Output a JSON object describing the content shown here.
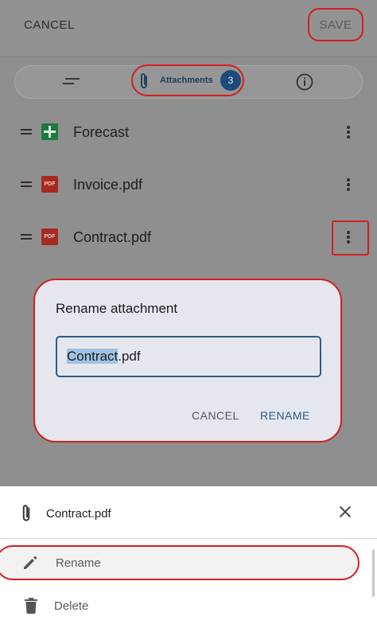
{
  "topbar": {
    "cancel_label": "CANCEL",
    "save_label": "SAVE"
  },
  "tabs": {
    "details_icon": "short-text-icon",
    "attachments_label": "Attachments",
    "attachments_count": "3",
    "info_icon": "info-icon"
  },
  "attachments": [
    {
      "name": "Forecast",
      "icon": "spreadsheet-icon"
    },
    {
      "name": "Invoice.pdf",
      "icon": "pdf-icon",
      "icon_text": "PDF"
    },
    {
      "name": "Contract.pdf",
      "icon": "pdf-icon",
      "icon_text": "PDF"
    }
  ],
  "dialog": {
    "title": "Rename attachment",
    "input_value_selected": "Contract",
    "input_value_rest": ".pdf",
    "cancel_label": "CANCEL",
    "rename_label": "RENAME"
  },
  "sheet": {
    "title": "Contract.pdf",
    "items": [
      {
        "label": "Rename",
        "icon": "pencil-icon"
      },
      {
        "label": "Delete",
        "icon": "trash-icon"
      }
    ]
  },
  "colors": {
    "accent": "#2a5d8f",
    "highlight": "#d31f1f",
    "sheet_green": "#1c7a3d",
    "pdf_red": "#a72a22"
  }
}
